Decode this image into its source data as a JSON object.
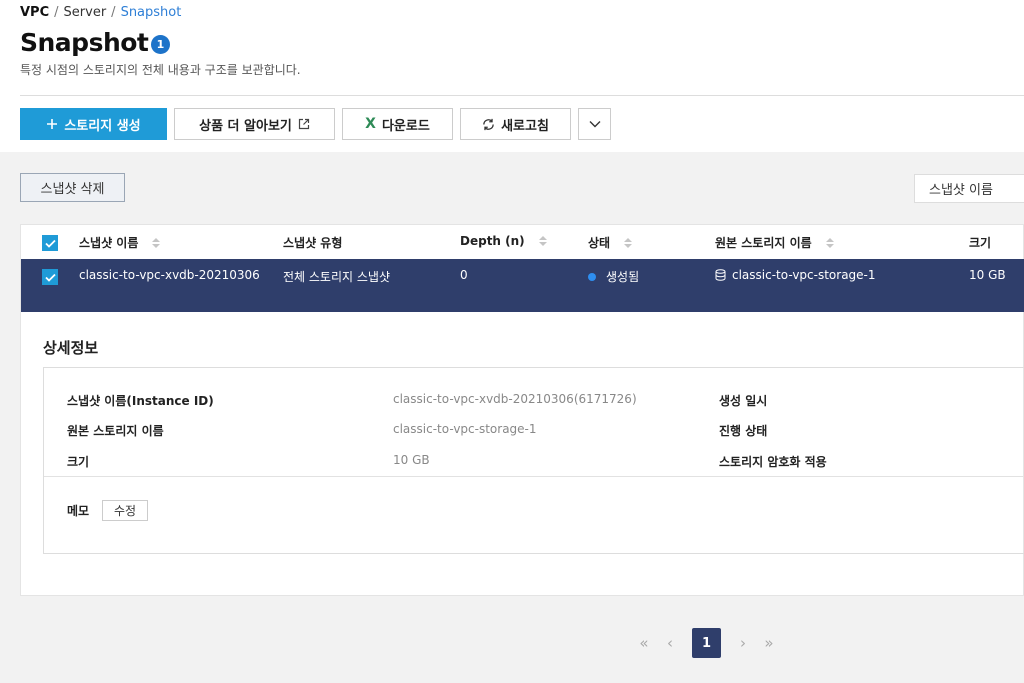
{
  "breadcrumb": {
    "root": "VPC",
    "parent": "Server",
    "current": "Snapshot"
  },
  "header": {
    "title": "Snapshot",
    "count": "1",
    "subtitle": "특정 시점의 스토리지의 전체 내용과 구조를 보관합니다."
  },
  "toolbar": {
    "create_label": "스토리지 생성",
    "learn_label": "상품 더 알아보기",
    "download_label": "다운로드",
    "refresh_label": "새로고침"
  },
  "actions": {
    "delete_label": "스냅샷 삭제",
    "search_filter": "스냅샷 이름"
  },
  "table": {
    "columns": {
      "name": "스냅샷 이름",
      "type": "스냅샷 유형",
      "depth": "Depth (n)",
      "status": "상태",
      "source": "원본 스토리지 이름",
      "size": "크기"
    },
    "rows": [
      {
        "name": "classic-to-vpc-xvdb-20210306",
        "type": "전체 스토리지 스냅샷",
        "depth": "0",
        "status": "생성됨",
        "source": "classic-to-vpc-storage-1",
        "size": "10 GB"
      }
    ]
  },
  "detail": {
    "title": "상세정보",
    "name_label": "스냅샷 이름(Instance ID)",
    "name_value": "classic-to-vpc-xvdb-20210306(6171726)",
    "source_label": "원본 스토리지 이름",
    "source_value": "classic-to-vpc-storage-1",
    "size_label": "크기",
    "size_value": "10 GB",
    "created_label": "생성 일시",
    "progress_label": "진행 상태",
    "encryption_label": "스토리지 암호화 적용",
    "memo_label": "메모",
    "memo_edit_label": "수정"
  },
  "pagination": {
    "current": "1"
  },
  "colors": {
    "accent": "#1f9bd7",
    "selected_row": "#2f3e6b",
    "status_dot": "#2e8ef0",
    "badge": "#1d73c9"
  }
}
